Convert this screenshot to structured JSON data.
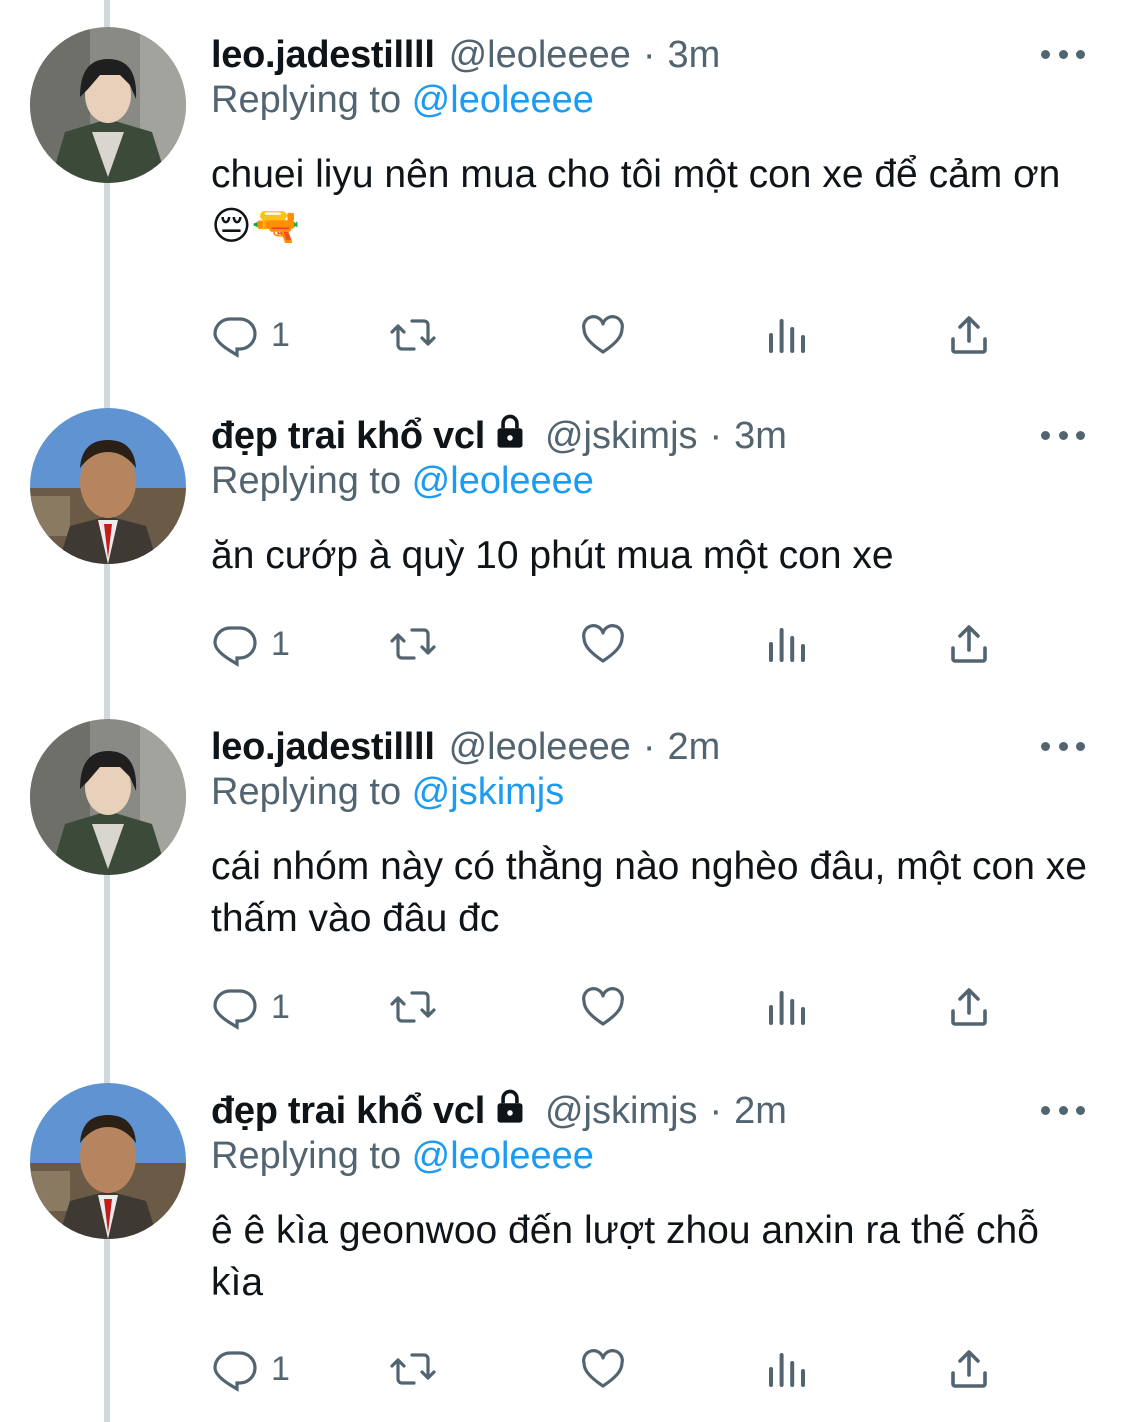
{
  "tweets": [
    {
      "name": "leo.jadestillll",
      "locked": false,
      "handle": "@leoleeee",
      "time": "3m",
      "reply_prefix": "Replying to ",
      "reply_to": "@leoleeee",
      "text": "chuei liyu nên mua cho tôi một con xe để cảm ơn😔🔫",
      "reply_count": "1"
    },
    {
      "name": "đẹp trai khổ vcl",
      "locked": true,
      "handle": "@jskimjs",
      "time": "3m",
      "reply_prefix": "Replying to ",
      "reply_to": "@leoleeee",
      "text": "ăn cướp à quỳ 10 phút mua một con xe",
      "reply_count": "1"
    },
    {
      "name": "leo.jadestillll",
      "locked": false,
      "handle": "@leoleeee",
      "time": "2m",
      "reply_prefix": "Replying to ",
      "reply_to": "@jskimjs",
      "text": "cái nhóm này có thằng nào nghèo đâu, một con xe thấm vào đâu đc",
      "reply_count": "1"
    },
    {
      "name": "đẹp trai khổ vcl",
      "locked": true,
      "handle": "@jskimjs",
      "time": "2m",
      "reply_prefix": "Replying to ",
      "reply_to": "@leoleeee",
      "text": "ê ê kìa geonwoo đến lượt zhou anxin ra thế chỗ kìa",
      "reply_count": "1"
    }
  ],
  "icons": {
    "reply": "reply-icon",
    "retweet": "retweet-icon",
    "like": "heart-icon",
    "views": "analytics-icon",
    "share": "share-icon",
    "more": "more-icon",
    "lock": "lock-icon"
  },
  "colors": {
    "text": "#0f1419",
    "secondary": "#536471",
    "mention": "#1d9bf0",
    "thread_line": "#cfd9de"
  }
}
